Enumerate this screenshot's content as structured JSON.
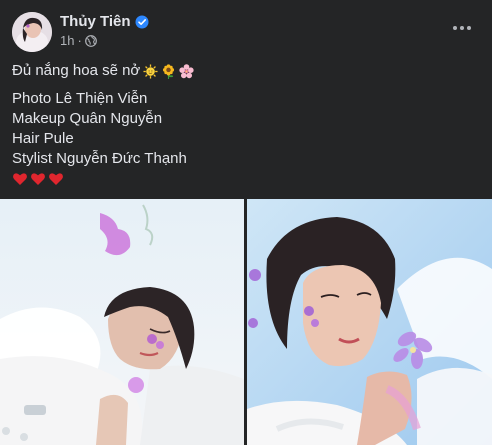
{
  "post": {
    "author": {
      "name": "Thủy Tiên",
      "verified": true,
      "avatar_icon": "profile-photo"
    },
    "meta": {
      "time": "1h",
      "separator": "·",
      "privacy_icon": "globe-icon"
    },
    "more_icon": "more-options-icon",
    "caption": "Đủ nắng hoa sẽ nở",
    "caption_emojis": [
      "sun-with-face-icon",
      "sunflower-icon",
      "cherry-blossom-icon"
    ],
    "credits": [
      "Photo Lê Thiện Viễn",
      "Makeup Quân Nguyễn",
      "Hair Pule",
      "Stylist Nguyễn Đức Thạnh"
    ],
    "hearts": [
      "heart-icon",
      "heart-icon",
      "heart-icon"
    ],
    "photos": [
      "photo-portrait-reclining-flower",
      "photo-portrait-holding-flower"
    ]
  },
  "colors": {
    "background": "#242526",
    "text_primary": "#e4e6eb",
    "text_secondary": "#b0b3b8",
    "verified_blue": "#2d88ff",
    "heart_red": "#e0262e"
  }
}
